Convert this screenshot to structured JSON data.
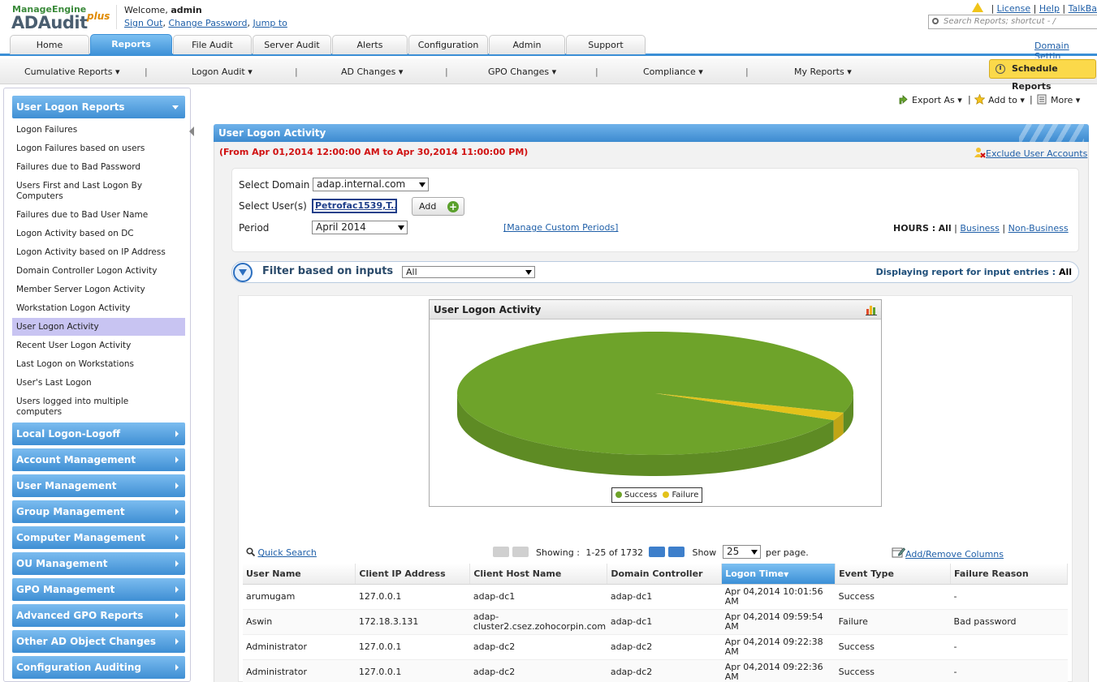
{
  "header": {
    "logo_brand": "ManageEngine",
    "logo_product": "ADAudit",
    "logo_plus": "plus",
    "welcome_label": "Welcome, ",
    "username": "admin",
    "links": [
      "Sign Out",
      "Change Password",
      "Jump to"
    ],
    "top_links": [
      "License",
      "Help",
      "TalkBa"
    ],
    "search_placeholder": "Search Reports; shortcut - /"
  },
  "tabs": [
    "Home",
    "Reports",
    "File Audit",
    "Server Audit",
    "Alerts",
    "Configuration",
    "Admin",
    "Support"
  ],
  "active_tab": "Reports",
  "domain_settings": "Domain Settin",
  "subnav": {
    "items": [
      "Cumulative Reports ▾",
      "Logon Audit ▾",
      "AD Changes ▾",
      "GPO Changes ▾",
      "Compliance ▾",
      "My Reports ▾"
    ],
    "schedule_label": "Schedule Reports"
  },
  "sidebar": {
    "open_section": "User Logon Reports",
    "items": [
      "Logon Failures",
      "Logon Failures based on users",
      "Failures due to Bad Password",
      "Users First and Last Logon By Computers",
      "Failures due to Bad User Name",
      "Logon Activity based on DC",
      "Logon Activity based on IP Address",
      "Domain Controller Logon Activity",
      "Member Server Logon Activity",
      "Workstation Logon Activity",
      "User Logon Activity",
      "Recent User Logon Activity",
      "Last Logon on Workstations",
      "User's Last Logon",
      "Users logged into multiple computers"
    ],
    "selected_item": "User Logon Activity",
    "sections": [
      "Local Logon-Logoff",
      "Account Management",
      "User Management",
      "Group Management",
      "Computer Management",
      "OU Management",
      "GPO Management",
      "Advanced GPO Reports",
      "Other AD Object Changes",
      "Configuration Auditing"
    ]
  },
  "toolbar": {
    "export": "Export As ▾",
    "add_to": "Add to ▾",
    "more": "More ▾"
  },
  "report": {
    "title": "User Logon Activity",
    "date_range": "(From Apr 01,2014 12:00:00 AM to Apr 30,2014 11:00:00 PM)",
    "exclude_label": "Exclude User Accounts"
  },
  "form": {
    "domain_label": "Select Domain",
    "domain_value": "adap.internal.com",
    "users_label": "Select User(s)",
    "users_value": "Petrofac1539,T...",
    "add_label": "Add",
    "period_label": "Period",
    "period_value": "April 2014",
    "manage_periods": "[Manage Custom Periods]",
    "hours_label": "HOURS :",
    "hours_all": "All",
    "hours_business": "Business",
    "hours_nonbusiness": "Non-Business"
  },
  "filter": {
    "title": "Filter based on inputs",
    "value": "All",
    "displaying_label": "Displaying report for input entries :",
    "displaying_value": "All"
  },
  "chart_data": {
    "type": "pie",
    "title": "User Logon Activity",
    "series": [
      {
        "name": "Success",
        "value": 1696,
        "color": "#6ea32a"
      },
      {
        "name": "Failure",
        "value": 36,
        "color": "#e3c21a"
      }
    ]
  },
  "table": {
    "quick_search": "Quick Search",
    "showing_label": "Showing :",
    "showing_range": "1-25 of 1732",
    "show_label": "Show",
    "per_page_value": "25",
    "per_page_label": "per page.",
    "add_remove": "Add/Remove Columns",
    "columns": [
      "User Name",
      "Client IP Address",
      "Client Host Name",
      "Domain Controller",
      "Logon Time",
      "Event Type",
      "Failure Reason"
    ],
    "sorted_column": "Logon Time",
    "rows": [
      [
        "arumugam",
        "127.0.0.1",
        "adap-dc1",
        "adap-dc1",
        "Apr 04,2014 10:01:56 AM",
        "Success",
        "-"
      ],
      [
        "Aswin",
        "172.18.3.131",
        "adap-cluster2.csez.zohocorpin.com",
        "adap-dc1",
        "Apr 04,2014 09:59:54 AM",
        "Failure",
        "Bad password"
      ],
      [
        "Administrator",
        "127.0.0.1",
        "adap-dc2",
        "adap-dc2",
        "Apr 04,2014 09:22:38 AM",
        "Success",
        "-"
      ],
      [
        "Administrator",
        "127.0.0.1",
        "adap-dc2",
        "adap-dc2",
        "Apr 04,2014 09:22:36 AM",
        "Success",
        "-"
      ]
    ]
  }
}
